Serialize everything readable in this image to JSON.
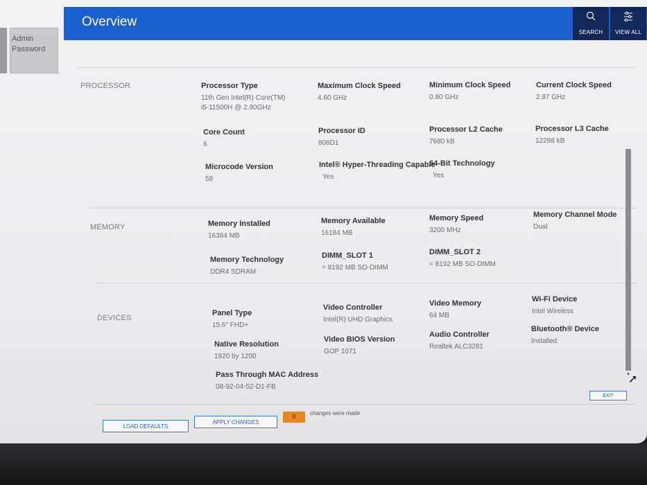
{
  "sidebar": {
    "item_line1": "Admin",
    "item_line2": "Password"
  },
  "header": {
    "title": "Overview",
    "search_label": "SEARCH",
    "view_all_label": "VIEW ALL"
  },
  "processor": {
    "label": "PROCESSOR",
    "fields": [
      {
        "key": "Processor Type",
        "value": "11th Gen Intel(R) Core(TM)\ni5-11500H @ 2.90GHz"
      },
      {
        "key": "Maximum Clock Speed",
        "value": "4.60 GHz"
      },
      {
        "key": "Minimum Clock Speed",
        "value": "0.80 GHz"
      },
      {
        "key": "Current Clock Speed",
        "value": "2.87 GHz"
      },
      {
        "key": "Core Count",
        "value": "6"
      },
      {
        "key": "Processor ID",
        "value": "806D1"
      },
      {
        "key": "Processor L2 Cache",
        "value": "7680 kB"
      },
      {
        "key": "Processor L3 Cache",
        "value": "12288 kB"
      },
      {
        "key": "Microcode Version",
        "value": "58"
      },
      {
        "key": "Intel® Hyper-Threading Capable",
        "value": "Yes"
      },
      {
        "key": "64-Bit Technology",
        "value": "Yes"
      }
    ]
  },
  "memory": {
    "label": "MEMORY",
    "fields": [
      {
        "key": "Memory Installed",
        "value": "16384 MB"
      },
      {
        "key": "Memory Available",
        "value": "16184 MB"
      },
      {
        "key": "Memory Speed",
        "value": "3200 MHz"
      },
      {
        "key": "Memory Channel Mode",
        "value": "Dual"
      },
      {
        "key": "Memory Technology",
        "value": "DDR4 SDRAM"
      },
      {
        "key": "DIMM_SLOT 1",
        "value": "= 8192 MB SO-DIMM"
      },
      {
        "key": "DIMM_SLOT 2",
        "value": "= 8192 MB SO-DIMM"
      }
    ]
  },
  "devices": {
    "label": "DEVICES",
    "fields": [
      {
        "key": "Panel Type",
        "value": "15.6\" FHD+"
      },
      {
        "key": "Video Controller",
        "value": "Intel(R) UHD Graphics"
      },
      {
        "key": "Video Memory",
        "value": "64 MB"
      },
      {
        "key": "Wi-Fi Device",
        "value": "Intel Wireless"
      },
      {
        "key": "Native Resolution",
        "value": "1920 by 1200"
      },
      {
        "key": "Video BIOS Version",
        "value": "GOP 1071"
      },
      {
        "key": "Audio Controller",
        "value": "Realtek ALC3281"
      },
      {
        "key": "Bluetooth® Device",
        "value": "Installed"
      },
      {
        "key": "Pass Through MAC Address",
        "value": "08-92-04-52-D1-FB"
      }
    ]
  },
  "footer": {
    "exit_label": "EXIT",
    "load_defaults_label": "LOAD DEFAULTS",
    "apply_changes_label": "APPLY CHANGES",
    "changes_count": "0",
    "changes_text": "changes were made"
  }
}
